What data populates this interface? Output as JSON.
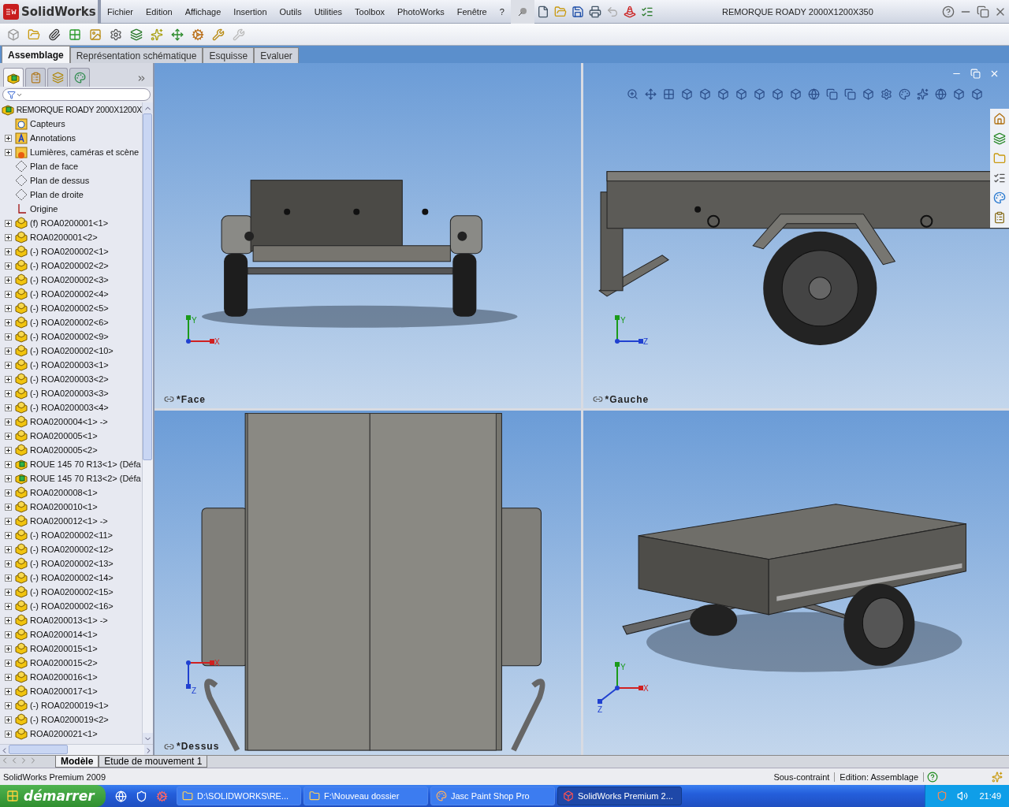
{
  "app": {
    "logo": "SolidWorks",
    "title": "REMORQUE ROADY 2000X1200X350"
  },
  "menu": [
    "Fichier",
    "Edition",
    "Affichage",
    "Insertion",
    "Outils",
    "Utilities",
    "Toolbox",
    "PhotoWorks",
    "Fenêtre",
    "?"
  ],
  "command_tabs": [
    {
      "label": "Assemblage",
      "selected": true
    },
    {
      "label": "Représentation schématique",
      "selected": false
    },
    {
      "label": "Esquisse",
      "selected": false
    },
    {
      "label": "Evaluer",
      "selected": false
    }
  ],
  "tree": {
    "label": "REMORQUE ROADY 2000X1200X",
    "kind": "assembly",
    "children": [
      {
        "label": "Capteurs",
        "kind": "sensor",
        "expandable": false
      },
      {
        "label": "Annotations",
        "kind": "annotation",
        "expandable": true
      },
      {
        "label": "Lumières, caméras et scène",
        "kind": "lights",
        "expandable": true
      },
      {
        "label": "Plan de face",
        "kind": "plane",
        "expandable": false
      },
      {
        "label": "Plan de dessus",
        "kind": "plane",
        "expandable": false
      },
      {
        "label": "Plan de droite",
        "kind": "plane",
        "expandable": false
      },
      {
        "label": "Origine",
        "kind": "origin",
        "expandable": false
      },
      {
        "label": "(f) ROA0200001<1>",
        "kind": "part",
        "expandable": true
      },
      {
        "label": "ROA0200001<2>",
        "kind": "part",
        "expandable": true
      },
      {
        "label": "(-) ROA0200002<1>",
        "kind": "part",
        "expandable": true
      },
      {
        "label": "(-) ROA0200002<2>",
        "kind": "part",
        "expandable": true
      },
      {
        "label": "(-) ROA0200002<3>",
        "kind": "part",
        "expandable": true
      },
      {
        "label": "(-) ROA0200002<4>",
        "kind": "part",
        "expandable": true
      },
      {
        "label": "(-) ROA0200002<5>",
        "kind": "part",
        "expandable": true
      },
      {
        "label": "(-) ROA0200002<6>",
        "kind": "part",
        "expandable": true
      },
      {
        "label": "(-) ROA0200002<9>",
        "kind": "part",
        "expandable": true
      },
      {
        "label": "(-) ROA0200002<10>",
        "kind": "part",
        "expandable": true
      },
      {
        "label": "(-) ROA0200003<1>",
        "kind": "part",
        "expandable": true
      },
      {
        "label": "(-) ROA0200003<2>",
        "kind": "part",
        "expandable": true
      },
      {
        "label": "(-) ROA0200003<3>",
        "kind": "part",
        "expandable": true
      },
      {
        "label": "(-) ROA0200003<4>",
        "kind": "part",
        "expandable": true
      },
      {
        "label": "ROA0200004<1> ->",
        "kind": "part",
        "expandable": true
      },
      {
        "label": "ROA0200005<1>",
        "kind": "part",
        "expandable": true
      },
      {
        "label": "ROA0200005<2>",
        "kind": "part",
        "expandable": true
      },
      {
        "label": "ROUE 145 70 R13<1> (Défa",
        "kind": "assembly",
        "expandable": true
      },
      {
        "label": "ROUE 145 70 R13<2> (Défa",
        "kind": "assembly",
        "expandable": true
      },
      {
        "label": "ROA0200008<1>",
        "kind": "part",
        "expandable": true
      },
      {
        "label": "ROA0200010<1>",
        "kind": "part",
        "expandable": true
      },
      {
        "label": "ROA0200012<1> ->",
        "kind": "part",
        "expandable": true
      },
      {
        "label": "(-) ROA0200002<11>",
        "kind": "part",
        "expandable": true
      },
      {
        "label": "(-) ROA0200002<12>",
        "kind": "part",
        "expandable": true
      },
      {
        "label": "(-) ROA0200002<13>",
        "kind": "part",
        "expandable": true
      },
      {
        "label": "(-) ROA0200002<14>",
        "kind": "part",
        "expandable": true
      },
      {
        "label": "(-) ROA0200002<15>",
        "kind": "part",
        "expandable": true
      },
      {
        "label": "(-) ROA0200002<16>",
        "kind": "part",
        "expandable": true
      },
      {
        "label": "ROA0200013<1> ->",
        "kind": "part",
        "expandable": true
      },
      {
        "label": "ROA0200014<1>",
        "kind": "part",
        "expandable": true
      },
      {
        "label": "ROA0200015<1>",
        "kind": "part",
        "expandable": true
      },
      {
        "label": "ROA0200015<2>",
        "kind": "part",
        "expandable": true
      },
      {
        "label": "ROA0200016<1>",
        "kind": "part",
        "expandable": true
      },
      {
        "label": "ROA0200017<1>",
        "kind": "part",
        "expandable": true
      },
      {
        "label": "(-) ROA0200019<1>",
        "kind": "part",
        "expandable": true
      },
      {
        "label": "(-) ROA0200019<2>",
        "kind": "part",
        "expandable": true
      },
      {
        "label": "ROA0200021<1>",
        "kind": "part",
        "expandable": true
      }
    ]
  },
  "viewports": [
    {
      "label": "*Face",
      "kind": "front",
      "axes": [
        {
          "label": "Y",
          "kind": "up",
          "color": "#1a9a1a"
        },
        {
          "label": "X",
          "kind": "right",
          "color": "#d02020"
        }
      ]
    },
    {
      "label": "*Gauche",
      "kind": "side",
      "axes": [
        {
          "label": "Y",
          "kind": "up",
          "color": "#1a9a1a"
        },
        {
          "label": "Z",
          "kind": "right",
          "color": "#2040d0"
        }
      ]
    },
    {
      "label": "*Dessus",
      "kind": "top",
      "axes": [
        {
          "label": "X",
          "kind": "right",
          "color": "#d02020"
        },
        {
          "label": "Z",
          "kind": "down",
          "color": "#2040d0"
        }
      ]
    },
    {
      "kind": "iso",
      "axes": [
        {
          "label": "Y",
          "kind": "up",
          "color": "#1a9a1a"
        },
        {
          "label": "X",
          "kind": "right",
          "color": "#d02020"
        },
        {
          "label": "Z",
          "kind": "left",
          "color": "#2040d0"
        }
      ]
    }
  ],
  "bottom_tabs": [
    {
      "label": "Modèle",
      "selected": true
    },
    {
      "label": "Etude de mouvement 1",
      "selected": false
    }
  ],
  "status_bar": {
    "product": "SolidWorks Premium 2009",
    "constraint": "Sous-contraint",
    "mode": "Edition: Assemblage"
  },
  "taskbar": {
    "start": "démarrer",
    "tasks": [
      {
        "label": "D:\\SOLIDWORKS\\RE...",
        "kind": "folder",
        "selected": false
      },
      {
        "label": "F:\\Nouveau dossier",
        "kind": "folder",
        "selected": false
      },
      {
        "label": "Jasc Paint Shop Pro",
        "kind": "paint",
        "selected": false
      },
      {
        "label": "SolidWorks Premium 2...",
        "kind": "solidworks",
        "selected": true
      }
    ],
    "clock": "21:49"
  }
}
